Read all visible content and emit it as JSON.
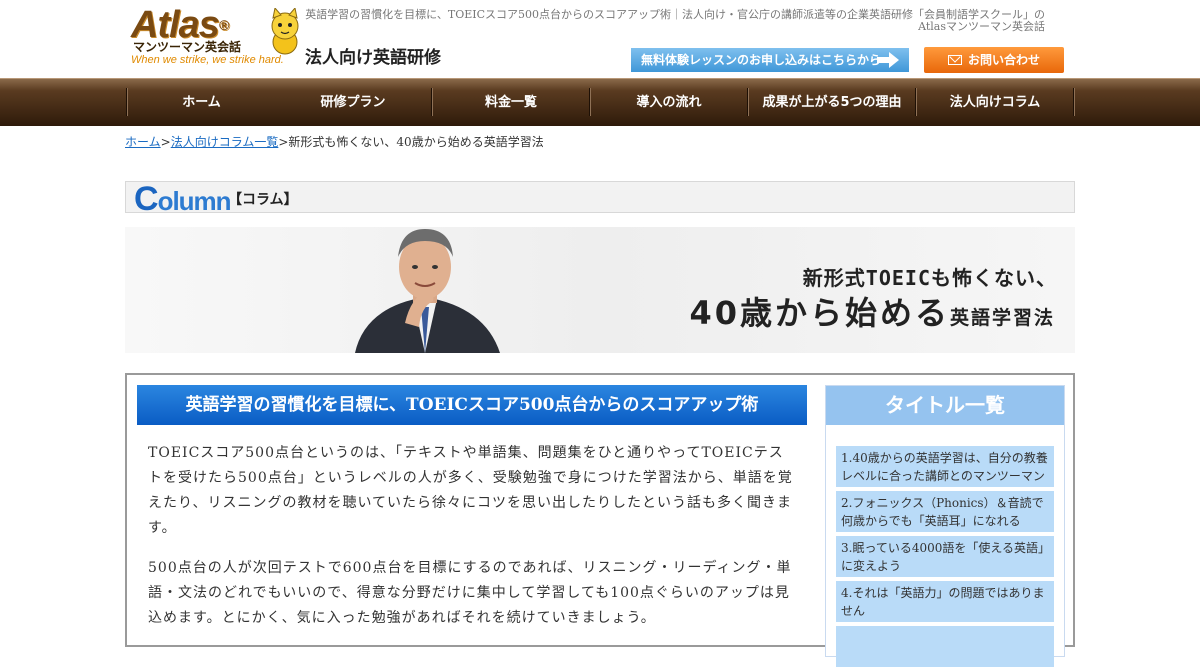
{
  "header": {
    "logo_main": "Atlas",
    "logo_reg": "®",
    "logo_sub": "マンツーマン英会話",
    "logo_tagline": "When we strike, we strike hard.",
    "site_title": "法人向け英語研修",
    "tagline_line1": "英語学習の習慣化を目標に、TOEICスコア500点台からのスコアアップ術｜法人向け・官公庁の講師派遣等の企業英語研修「会員制語学スクール」の",
    "tagline_line2": "Atlasマンツーマン英会話",
    "trial_button": "無料体験レッスンのお申し込みはこちらから",
    "contact_button": "お問い合わせ"
  },
  "nav": {
    "items": [
      "ホーム",
      "研修プラン",
      "料金一覧",
      "導入の流れ",
      "成果が上がる5つの理由",
      "法人向けコラム"
    ]
  },
  "breadcrumb": {
    "home": "ホーム",
    "sep1": ">",
    "column_list": "法人向けコラム一覧",
    "sep2": ">",
    "current": "新形式も怖くない、40歳から始める英語学習法"
  },
  "column_bar": {
    "logo_first": "C",
    "logo_rest": "olumn",
    "label": "【コラム】"
  },
  "hero": {
    "line1": "新形式TOEICも怖くない、",
    "line2_big": "40歳から始める",
    "line2_small": "英語学習法"
  },
  "article": {
    "heading": "英語学習の習慣化を目標に、TOEICスコア500点台からのスコアアップ術",
    "para1": "TOEICスコア500点台というのは、「テキストや単語集、問題集をひと通りやってTOEICテストを受けたら500点台」というレベルの人が多く、受験勉強で身につけた学習法から、単語を覚えたり、リスニングの教材を聴いていたら徐々にコツを思い出したりしたという話も多く聞きます。",
    "para2": "500点台の人が次回テストで600点台を目標にするのであれば、リスニング・リーディング・単語・文法のどれでもいいので、得意な分野だけに集中して学習しても100点ぐらいのアップは見込めます。とにかく、気に入った勉強があればそれを続けていきましょう。"
  },
  "sidebar": {
    "title": "タイトル一覧",
    "items": [
      "1.40歳からの英語学習は、自分の教養レベルに合った講師とのマンツーマン",
      "2.フォニックス（Phonics）＆音読で何歳からでも「英語耳」になれる",
      "3.眠っている4000語を「使える英語」に変えよう",
      "4.それは「英語力」の問題ではありません"
    ]
  },
  "colors": {
    "nav_dark": "#2e1a0a",
    "article_head_blue": "#0a5cc4",
    "sidebar_title_blue": "#95c3ef",
    "sidebar_item_blue": "#b9dbf8",
    "contact_orange": "#e8670a",
    "trial_blue": "#3f97d8",
    "link_blue": "#1a6bc2"
  }
}
